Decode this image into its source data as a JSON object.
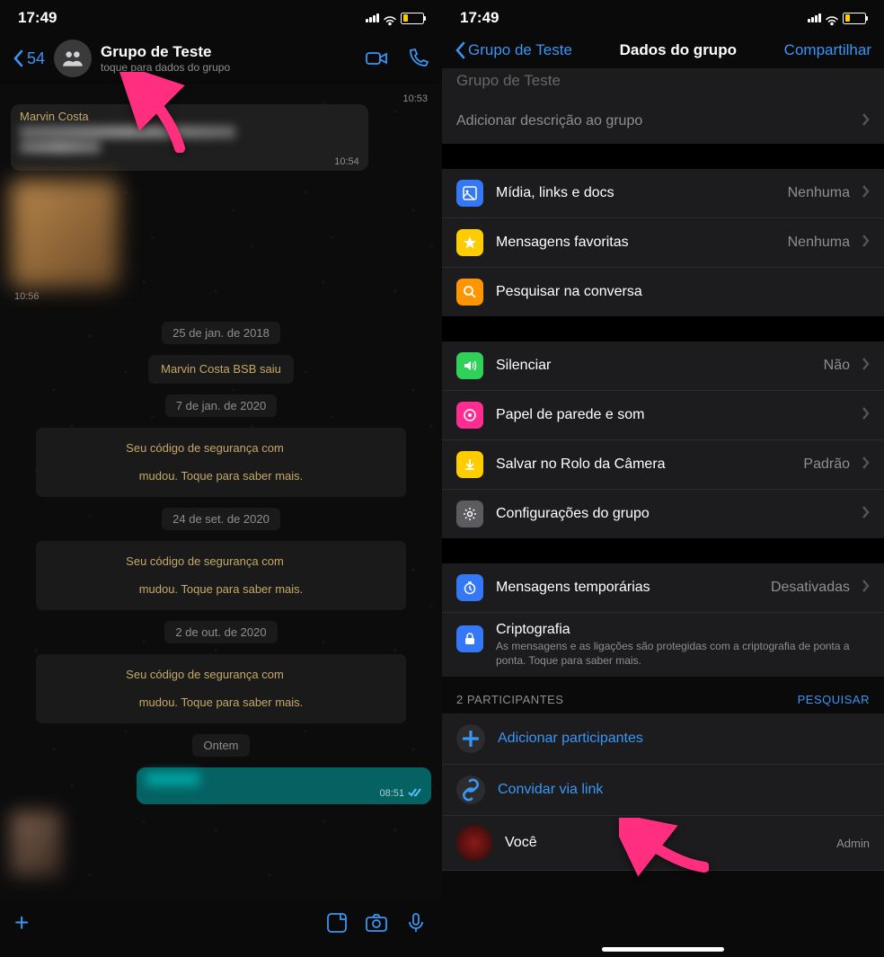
{
  "left": {
    "status": {
      "time": "17:49",
      "battery_pct": 25
    },
    "header": {
      "back_count": "54",
      "title": "Grupo de Teste",
      "subtitle": "toque para dados do grupo"
    },
    "chat": {
      "sender_name": "Marvin Costa",
      "msg1_time": "10:54",
      "img_time": "10:56",
      "date1": "25 de jan. de 2018",
      "system1": "Marvin Costa BSB saiu",
      "date2": "7 de jan. de 2020",
      "security_prefix": "Seu código de segurança com ",
      "security_suffix": " mudou. Toque para saber mais.",
      "date3": "24 de set. de 2020",
      "date4": "2 de out. de 2020",
      "date5": "Ontem",
      "out_time": "08:51"
    }
  },
  "right": {
    "status": {
      "time": "17:49",
      "battery_pct": 25
    },
    "header": {
      "back": "Grupo de Teste",
      "title": "Dados do grupo",
      "share": "Compartilhar"
    },
    "top_section": {
      "title_partial": "Grupo de Teste",
      "add_desc": "Adicionar descrição ao grupo"
    },
    "media_section": {
      "media": {
        "label": "Mídia, links e docs",
        "value": "Nenhuma"
      },
      "starred": {
        "label": "Mensagens favoritas",
        "value": "Nenhuma"
      },
      "search": {
        "label": "Pesquisar na conversa"
      }
    },
    "settings_section": {
      "mute": {
        "label": "Silenciar",
        "value": "Não"
      },
      "wallpaper": {
        "label": "Papel de parede e som"
      },
      "save_camera": {
        "label": "Salvar no Rolo da Câmera",
        "value": "Padrão"
      },
      "group_settings": {
        "label": "Configurações do grupo"
      }
    },
    "ephemeral_section": {
      "ephemeral": {
        "label": "Mensagens temporárias",
        "value": "Desativadas"
      },
      "encryption": {
        "label": "Criptografia",
        "desc": "As mensagens e as ligações são protegidas com a criptografia de ponta a ponta. Toque para saber mais."
      }
    },
    "participants": {
      "header": "2 PARTICIPANTES",
      "search": "PESQUISAR",
      "add": "Adicionar participantes",
      "invite": "Convidar via link",
      "you": {
        "name": "Você",
        "role": "Admin"
      }
    }
  }
}
